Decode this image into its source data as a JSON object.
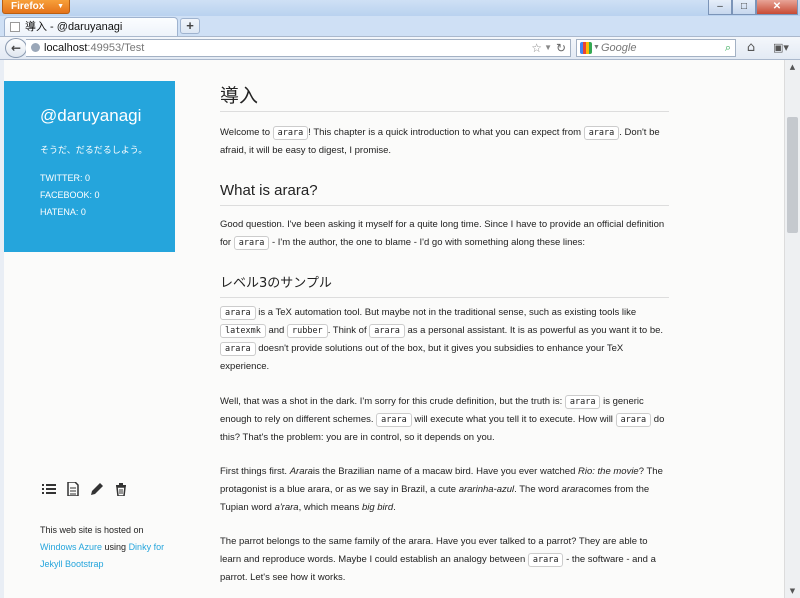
{
  "browser": {
    "app_button": "Firefox",
    "tab_title": "導入 - @daruyanagi",
    "new_tab": "+",
    "url_host": "localhost",
    "url_rest": ":49953/Test",
    "search_placeholder": "Google",
    "window_buttons": {
      "minimize": "–",
      "maximize": "□",
      "close": "✕"
    }
  },
  "sidebar": {
    "site_name": "@daruyanagi",
    "tagline": "そうだ、だるだるしよう。",
    "stats": [
      "TWITTER: 0",
      "FACEBOOK: 0",
      "HATENA: 0"
    ],
    "hosted_prefix": "This web site is hosted on",
    "hosted_link1": "Windows Azure",
    "hosted_using": " using ",
    "hosted_link2": "Dinky for Jekyll Bootstrap"
  },
  "article": {
    "title": "導入",
    "intro": [
      "Welcome to ",
      "arara",
      "! This chapter is a quick introduction to what you can expect from ",
      "arara",
      ". Don't be afraid, it will be easy to digest, I promise."
    ],
    "h2": "What is arara?",
    "p1": [
      "Good question. I've been asking it myself for a quite long time. Since I have to provide an official definition for ",
      "arara",
      " - I'm the author, the one to blame - I'd go with something along these lines:"
    ],
    "h3": "レベル3のサンプル",
    "p2": [
      "arara",
      " is a TeX automation tool. But maybe not in the traditional sense, such as existing tools like ",
      "latexmk",
      " and ",
      "rubber",
      ". Think of ",
      "arara",
      " as a personal assistant. It is as powerful as you want it to be. ",
      "arara",
      " doesn't provide solutions out of the box, but it gives you subsidies to enhance your TeX experience."
    ],
    "p3": [
      "Well, that was a shot in the dark. I'm sorry for this crude definition, but the truth is: ",
      "arara",
      " is generic enough to rely on different schemes. ",
      "arara",
      " will execute what you tell it to execute. How will ",
      "arara",
      " do this? That's the problem: you are in control, so it depends on you."
    ],
    "p4": [
      "First things first. ",
      "Arara",
      "is the Brazilian name of a macaw bird. Have you ever watched ",
      "Rio: the movie",
      "? The protagonist is a blue arara, or as we say in Brazil, a cute ",
      "ararinha-azul",
      ". The word ",
      "arara",
      "comes from the Tupian word ",
      "a'rara",
      ", which means ",
      "big bird",
      "."
    ],
    "p5": [
      "The parrot belongs to the same family of the arara. Have you ever talked to a parrot? They are able to learn and reproduce words. Maybe I could establish an analogy between ",
      "arara",
      " - the software - and a parrot. Let's see how it works."
    ]
  }
}
